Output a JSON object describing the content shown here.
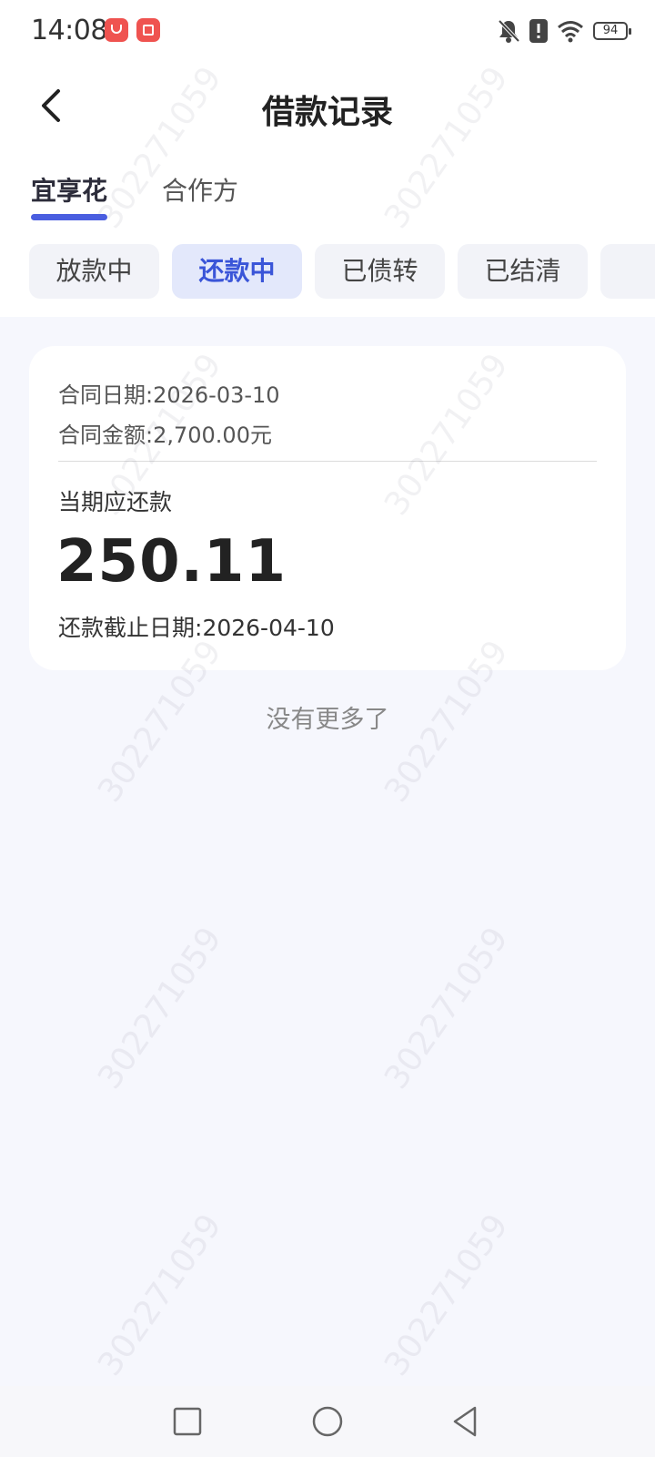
{
  "status_bar": {
    "time": "14:08",
    "battery": "94",
    "icons": [
      "app-red-bag-icon",
      "app-red-book-icon",
      "bell-off-icon",
      "alert-icon",
      "wifi-icon",
      "battery-icon"
    ]
  },
  "header": {
    "title": "借款记录",
    "back_icon": "chevron-left-icon"
  },
  "tabs": [
    {
      "label": "宜享花",
      "active": true
    },
    {
      "label": "合作方",
      "active": false
    }
  ],
  "filters": [
    {
      "label": "放款中",
      "active": false
    },
    {
      "label": "还款中",
      "active": true
    },
    {
      "label": "已债转",
      "active": false
    },
    {
      "label": "已结清",
      "active": false
    }
  ],
  "card": {
    "contract_date_label": "合同日期:",
    "contract_date": "2026-03-10",
    "contract_amount_label": "合同金额:",
    "contract_amount": "2,700.00元",
    "due_label": "当期应还款",
    "due_amount": "250.11",
    "due_deadline_label": "还款截止日期:",
    "due_deadline": "2026-04-10"
  },
  "no_more": "没有更多了",
  "watermark_text": "302271059",
  "colors": {
    "accent": "#4a5ee0",
    "chip_active_bg": "#e3e8fb",
    "chip_active_text": "#3a55d8",
    "page_bg": "#f6f7fd"
  },
  "navbar": {
    "icons": [
      "square-recent-icon",
      "circle-home-icon",
      "triangle-back-icon"
    ]
  }
}
